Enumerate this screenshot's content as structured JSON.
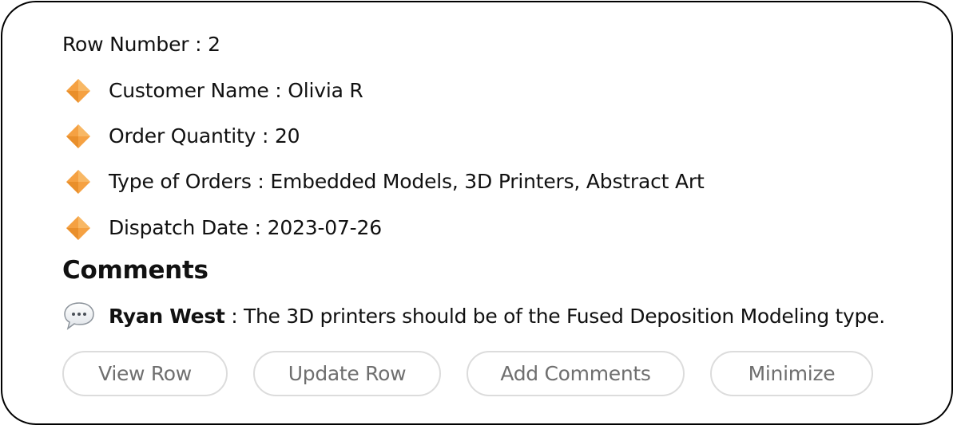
{
  "row_number": "Row Number : 2",
  "fields": [
    {
      "icon": "orange-diamond-icon",
      "text": "Customer Name : Olivia R"
    },
    {
      "icon": "orange-diamond-icon",
      "text": "Order Quantity : 20"
    },
    {
      "icon": "orange-diamond-icon",
      "text": "Type of Orders : Embedded Models, 3D Printers, Abstract Art"
    },
    {
      "icon": "orange-diamond-icon",
      "text": "Dispatch Date : 2023-07-26"
    }
  ],
  "comments": {
    "heading": "Comments",
    "items": [
      {
        "icon": "speech-bubble-icon",
        "author": "Ryan West",
        "text": " : The 3D printers should be of the Fused Deposition Modeling type."
      }
    ]
  },
  "buttons": {
    "view_row": "View Row",
    "update_row": "Update Row",
    "add_comments": "Add Comments",
    "minimize": "Minimize"
  },
  "colors": {
    "diamond": "#f5a142",
    "border": "#000000",
    "button_border": "#dcdcdc",
    "button_text": "#6f6f6f"
  }
}
